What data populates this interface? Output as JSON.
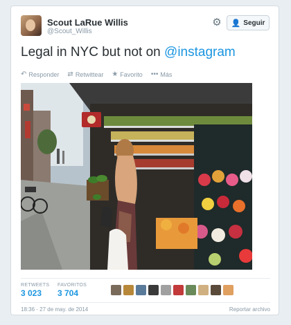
{
  "user": {
    "name": "Scout LaRue Willis",
    "handle": "@Scout_Willis"
  },
  "follow_button": {
    "label": "Seguir",
    "icon": "add-user-icon"
  },
  "settings_icon": "gear-icon",
  "tweet": {
    "text": "Legal in NYC but not on ",
    "mention": "@instagram"
  },
  "actions": [
    {
      "label": "Responder",
      "icon": "reply-icon"
    },
    {
      "label": "Retwittear",
      "icon": "retweet-icon"
    },
    {
      "label": "Favorito",
      "icon": "star-icon"
    },
    {
      "label": "Más",
      "icon": "more-icon"
    }
  ],
  "stats": {
    "retweets_label": "RETWEETS",
    "retweets_value": "3 023",
    "favorites_label": "FAVORITOS",
    "favorites_value": "3 704"
  },
  "favoriters_count": 10,
  "timestamp": "18:36 - 27 de may. de 2014",
  "report_label": "Reportar archivo",
  "colors": {
    "link": "#1b95e0",
    "muted": "#8899a6",
    "text": "#292f33"
  }
}
